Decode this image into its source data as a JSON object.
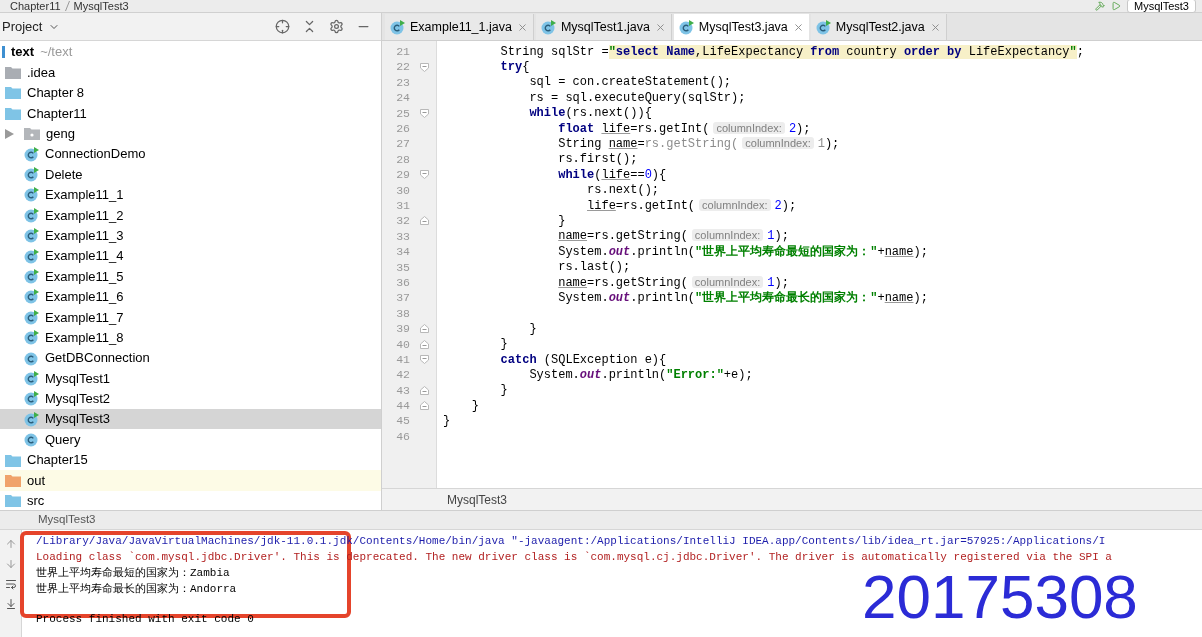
{
  "breadcrumb": [
    "Chapter11",
    "MysqlTest3"
  ],
  "run_config": "MysqlTest3",
  "project_panel": {
    "title": "Project",
    "tree": [
      {
        "name": "text",
        "note": "~/text",
        "kind": "module",
        "selected": false,
        "children": [
          {
            "name": ".idea",
            "kind": "config-folder",
            "selected": false
          },
          {
            "name": "Chapter 8",
            "kind": "folder",
            "selected": false
          },
          {
            "name": "Chapter11",
            "kind": "folder",
            "selected": false,
            "children": [
              {
                "name": "geng",
                "kind": "package",
                "expanded": false,
                "selected": false
              },
              {
                "name": "ConnectionDemo",
                "kind": "runnable",
                "selected": false
              },
              {
                "name": "Delete",
                "kind": "runnable",
                "selected": false
              },
              {
                "name": "Example11_1",
                "kind": "runnable",
                "selected": false
              },
              {
                "name": "Example11_2",
                "kind": "runnable",
                "selected": false
              },
              {
                "name": "Example11_3",
                "kind": "runnable",
                "selected": false
              },
              {
                "name": "Example11_4",
                "kind": "runnable",
                "selected": false
              },
              {
                "name": "Example11_5",
                "kind": "runnable",
                "selected": false
              },
              {
                "name": "Example11_6",
                "kind": "runnable",
                "selected": false
              },
              {
                "name": "Example11_7",
                "kind": "runnable",
                "selected": false
              },
              {
                "name": "Example11_8",
                "kind": "runnable",
                "selected": false
              },
              {
                "name": "GetDBConnection",
                "kind": "class",
                "selected": false
              },
              {
                "name": "MysqlTest1",
                "kind": "runnable",
                "selected": false
              },
              {
                "name": "MysqlTest2",
                "kind": "runnable",
                "selected": false
              },
              {
                "name": "MysqlTest3",
                "kind": "runnable",
                "selected": true
              },
              {
                "name": "Query",
                "kind": "class",
                "selected": false
              }
            ]
          },
          {
            "name": "Chapter15",
            "kind": "folder",
            "selected": false
          },
          {
            "name": "out",
            "kind": "excluded",
            "selected": false
          },
          {
            "name": "src",
            "kind": "folder",
            "selected": false
          }
        ]
      }
    ]
  },
  "editor": {
    "tabs": [
      {
        "label": "Example11_1.java",
        "selected": false
      },
      {
        "label": "MysqlTest1.java",
        "selected": false
      },
      {
        "label": "MysqlTest3.java",
        "selected": true
      },
      {
        "label": "MysqlTest2.java",
        "selected": false
      }
    ],
    "lines": [
      {
        "number": "21",
        "kind": "code",
        "tokens": [
          {
            "kind": "plain",
            "text": "        String sqlStr ="
          },
          {
            "kind": "sq",
            "text": "\""
          },
          {
            "kind": "sqlkw",
            "text": "select Name"
          },
          {
            "kind": "sql",
            "text": ",LifeExpectancy "
          },
          {
            "kind": "sqlkw",
            "text": "from"
          },
          {
            "kind": "sql",
            "text": " country "
          },
          {
            "kind": "sqlkw",
            "text": "order by"
          },
          {
            "kind": "sql",
            "text": " LifeExpectancy"
          },
          {
            "kind": "sq",
            "text": "\""
          },
          {
            "kind": "plain",
            "text": ";"
          }
        ]
      },
      {
        "number": "22",
        "kind": "fold-start",
        "tokens": [
          {
            "kind": "kw",
            "text": "        try"
          },
          {
            "kind": "plain",
            "text": "{"
          }
        ]
      },
      {
        "number": "23",
        "kind": "code",
        "tokens": [
          {
            "kind": "plain",
            "text": "            sql = con.createStatement();"
          }
        ]
      },
      {
        "number": "24",
        "kind": "code",
        "tokens": [
          {
            "kind": "plain",
            "text": "            rs = sql.executeQuery(sqlStr);"
          }
        ]
      },
      {
        "number": "25",
        "kind": "fold-start",
        "tokens": [
          {
            "kind": "kw",
            "text": "            while"
          },
          {
            "kind": "plain",
            "text": "(rs.next()){"
          }
        ]
      },
      {
        "number": "26",
        "kind": "code",
        "tokens": [
          {
            "kind": "kw",
            "text": "                float "
          },
          {
            "kind": "var",
            "text": "life"
          },
          {
            "kind": "plain",
            "text": "=rs.getInt("
          },
          {
            "kind": "hint",
            "text": "columnIndex:"
          },
          {
            "kind": "num",
            "text": "2"
          },
          {
            "kind": "plain",
            "text": ");"
          }
        ]
      },
      {
        "number": "27",
        "kind": "code",
        "tokens": [
          {
            "kind": "plain",
            "text": "                String "
          },
          {
            "kind": "var",
            "text": "name"
          },
          {
            "kind": "plain",
            "text": "="
          },
          {
            "kind": "dim",
            "text": "rs.getString("
          },
          {
            "kind": "hint",
            "text": "columnIndex:"
          },
          {
            "kind": "dim",
            "text": "1"
          },
          {
            "kind": "plain",
            "text": ");"
          }
        ]
      },
      {
        "number": "28",
        "kind": "code",
        "tokens": [
          {
            "kind": "plain",
            "text": "                rs.first();"
          }
        ]
      },
      {
        "number": "29",
        "kind": "fold-start",
        "tokens": [
          {
            "kind": "kw",
            "text": "                while"
          },
          {
            "kind": "plain",
            "text": "("
          },
          {
            "kind": "var",
            "text": "life"
          },
          {
            "kind": "plain",
            "text": "=="
          },
          {
            "kind": "num",
            "text": "0"
          },
          {
            "kind": "plain",
            "text": "){"
          }
        ]
      },
      {
        "number": "30",
        "kind": "code",
        "tokens": [
          {
            "kind": "plain",
            "text": "                    rs.next();"
          }
        ]
      },
      {
        "number": "31",
        "kind": "code",
        "tokens": [
          {
            "kind": "var",
            "text": "                    life"
          },
          {
            "kind": "plain",
            "text": "=rs.getInt("
          },
          {
            "kind": "hint",
            "text": "columnIndex:"
          },
          {
            "kind": "num",
            "text": "2"
          },
          {
            "kind": "plain",
            "text": ");"
          }
        ]
      },
      {
        "number": "32",
        "kind": "fold-end",
        "tokens": [
          {
            "kind": "plain",
            "text": "                }"
          }
        ]
      },
      {
        "number": "33",
        "kind": "code",
        "tokens": [
          {
            "kind": "var",
            "text": "                name"
          },
          {
            "kind": "plain",
            "text": "=rs.getString("
          },
          {
            "kind": "hint",
            "text": "columnIndex:"
          },
          {
            "kind": "num",
            "text": "1"
          },
          {
            "kind": "plain",
            "text": ");"
          }
        ]
      },
      {
        "number": "34",
        "kind": "code",
        "tokens": [
          {
            "kind": "plain",
            "text": "                System."
          },
          {
            "kind": "field",
            "text": "out"
          },
          {
            "kind": "plain",
            "text": ".println("
          },
          {
            "kind": "str",
            "text": "\"世界上平均寿命最短的国家为：\""
          },
          {
            "kind": "plain",
            "text": "+"
          },
          {
            "kind": "var",
            "text": "name"
          },
          {
            "kind": "plain",
            "text": ");"
          }
        ]
      },
      {
        "number": "35",
        "kind": "code",
        "tokens": [
          {
            "kind": "plain",
            "text": "                rs.last();"
          }
        ]
      },
      {
        "number": "36",
        "kind": "code",
        "tokens": [
          {
            "kind": "var",
            "text": "                name"
          },
          {
            "kind": "plain",
            "text": "=rs.getString("
          },
          {
            "kind": "hint",
            "text": "columnIndex:"
          },
          {
            "kind": "num",
            "text": "1"
          },
          {
            "kind": "plain",
            "text": ");"
          }
        ]
      },
      {
        "number": "37",
        "kind": "code",
        "tokens": [
          {
            "kind": "plain",
            "text": "                System."
          },
          {
            "kind": "field",
            "text": "out"
          },
          {
            "kind": "plain",
            "text": ".println("
          },
          {
            "kind": "str",
            "text": "\"世界上平均寿命最长的国家为：\""
          },
          {
            "kind": "plain",
            "text": "+"
          },
          {
            "kind": "var",
            "text": "name"
          },
          {
            "kind": "plain",
            "text": ");"
          }
        ]
      },
      {
        "number": "38",
        "kind": "code"
      },
      {
        "number": "39",
        "kind": "fold-end",
        "tokens": [
          {
            "kind": "plain",
            "text": "            }"
          }
        ]
      },
      {
        "number": "40",
        "kind": "fold-end",
        "tokens": [
          {
            "kind": "plain",
            "text": "        }"
          }
        ]
      },
      {
        "number": "41",
        "kind": "fold-start",
        "tokens": [
          {
            "kind": "kw",
            "text": "        catch"
          },
          {
            "kind": "plain",
            "text": " (SQLException e){"
          }
        ]
      },
      {
        "number": "42",
        "kind": "code",
        "tokens": [
          {
            "kind": "plain",
            "text": "            System."
          },
          {
            "kind": "field",
            "text": "out"
          },
          {
            "kind": "plain",
            "text": ".println("
          },
          {
            "kind": "str",
            "text": "\"Error:\""
          },
          {
            "kind": "plain",
            "text": "+e);"
          }
        ]
      },
      {
        "number": "43",
        "kind": "fold-end",
        "tokens": [
          {
            "kind": "plain",
            "text": "        }"
          }
        ]
      },
      {
        "number": "44",
        "kind": "fold-end",
        "tokens": [
          {
            "kind": "plain",
            "text": "    }"
          }
        ]
      },
      {
        "number": "45",
        "kind": "code",
        "tokens": [
          {
            "kind": "plain",
            "text": "}"
          }
        ]
      },
      {
        "number": "46",
        "kind": "code"
      }
    ],
    "breadcrumb": "MysqlTest3"
  },
  "run_panel": {
    "tab": "MysqlTest3",
    "console": [
      {
        "kind": "command",
        "text": "/Library/Java/JavaVirtualMachines/jdk-11.0.1.jdk/Contents/Home/bin/java \"-javaagent:/Applications/IntelliJ IDEA.app/Contents/lib/idea_rt.jar=57925:/Applications/I"
      },
      {
        "kind": "warning",
        "text": "Loading class `com.mysql.jdbc.Driver'. This is deprecated. The new driver class is `com.mysql.cj.jdbc.Driver'. The driver is automatically registered via the SPI a"
      },
      {
        "kind": "output",
        "text": "世界上平均寿命最短的国家为：Zambia"
      },
      {
        "kind": "output",
        "text": "世界上平均寿命最长的国家为：Andorra"
      },
      {
        "kind": "blank"
      },
      {
        "kind": "output",
        "text": "Process finished with exit code 0"
      }
    ]
  },
  "annotation": {
    "text": "20175308"
  }
}
